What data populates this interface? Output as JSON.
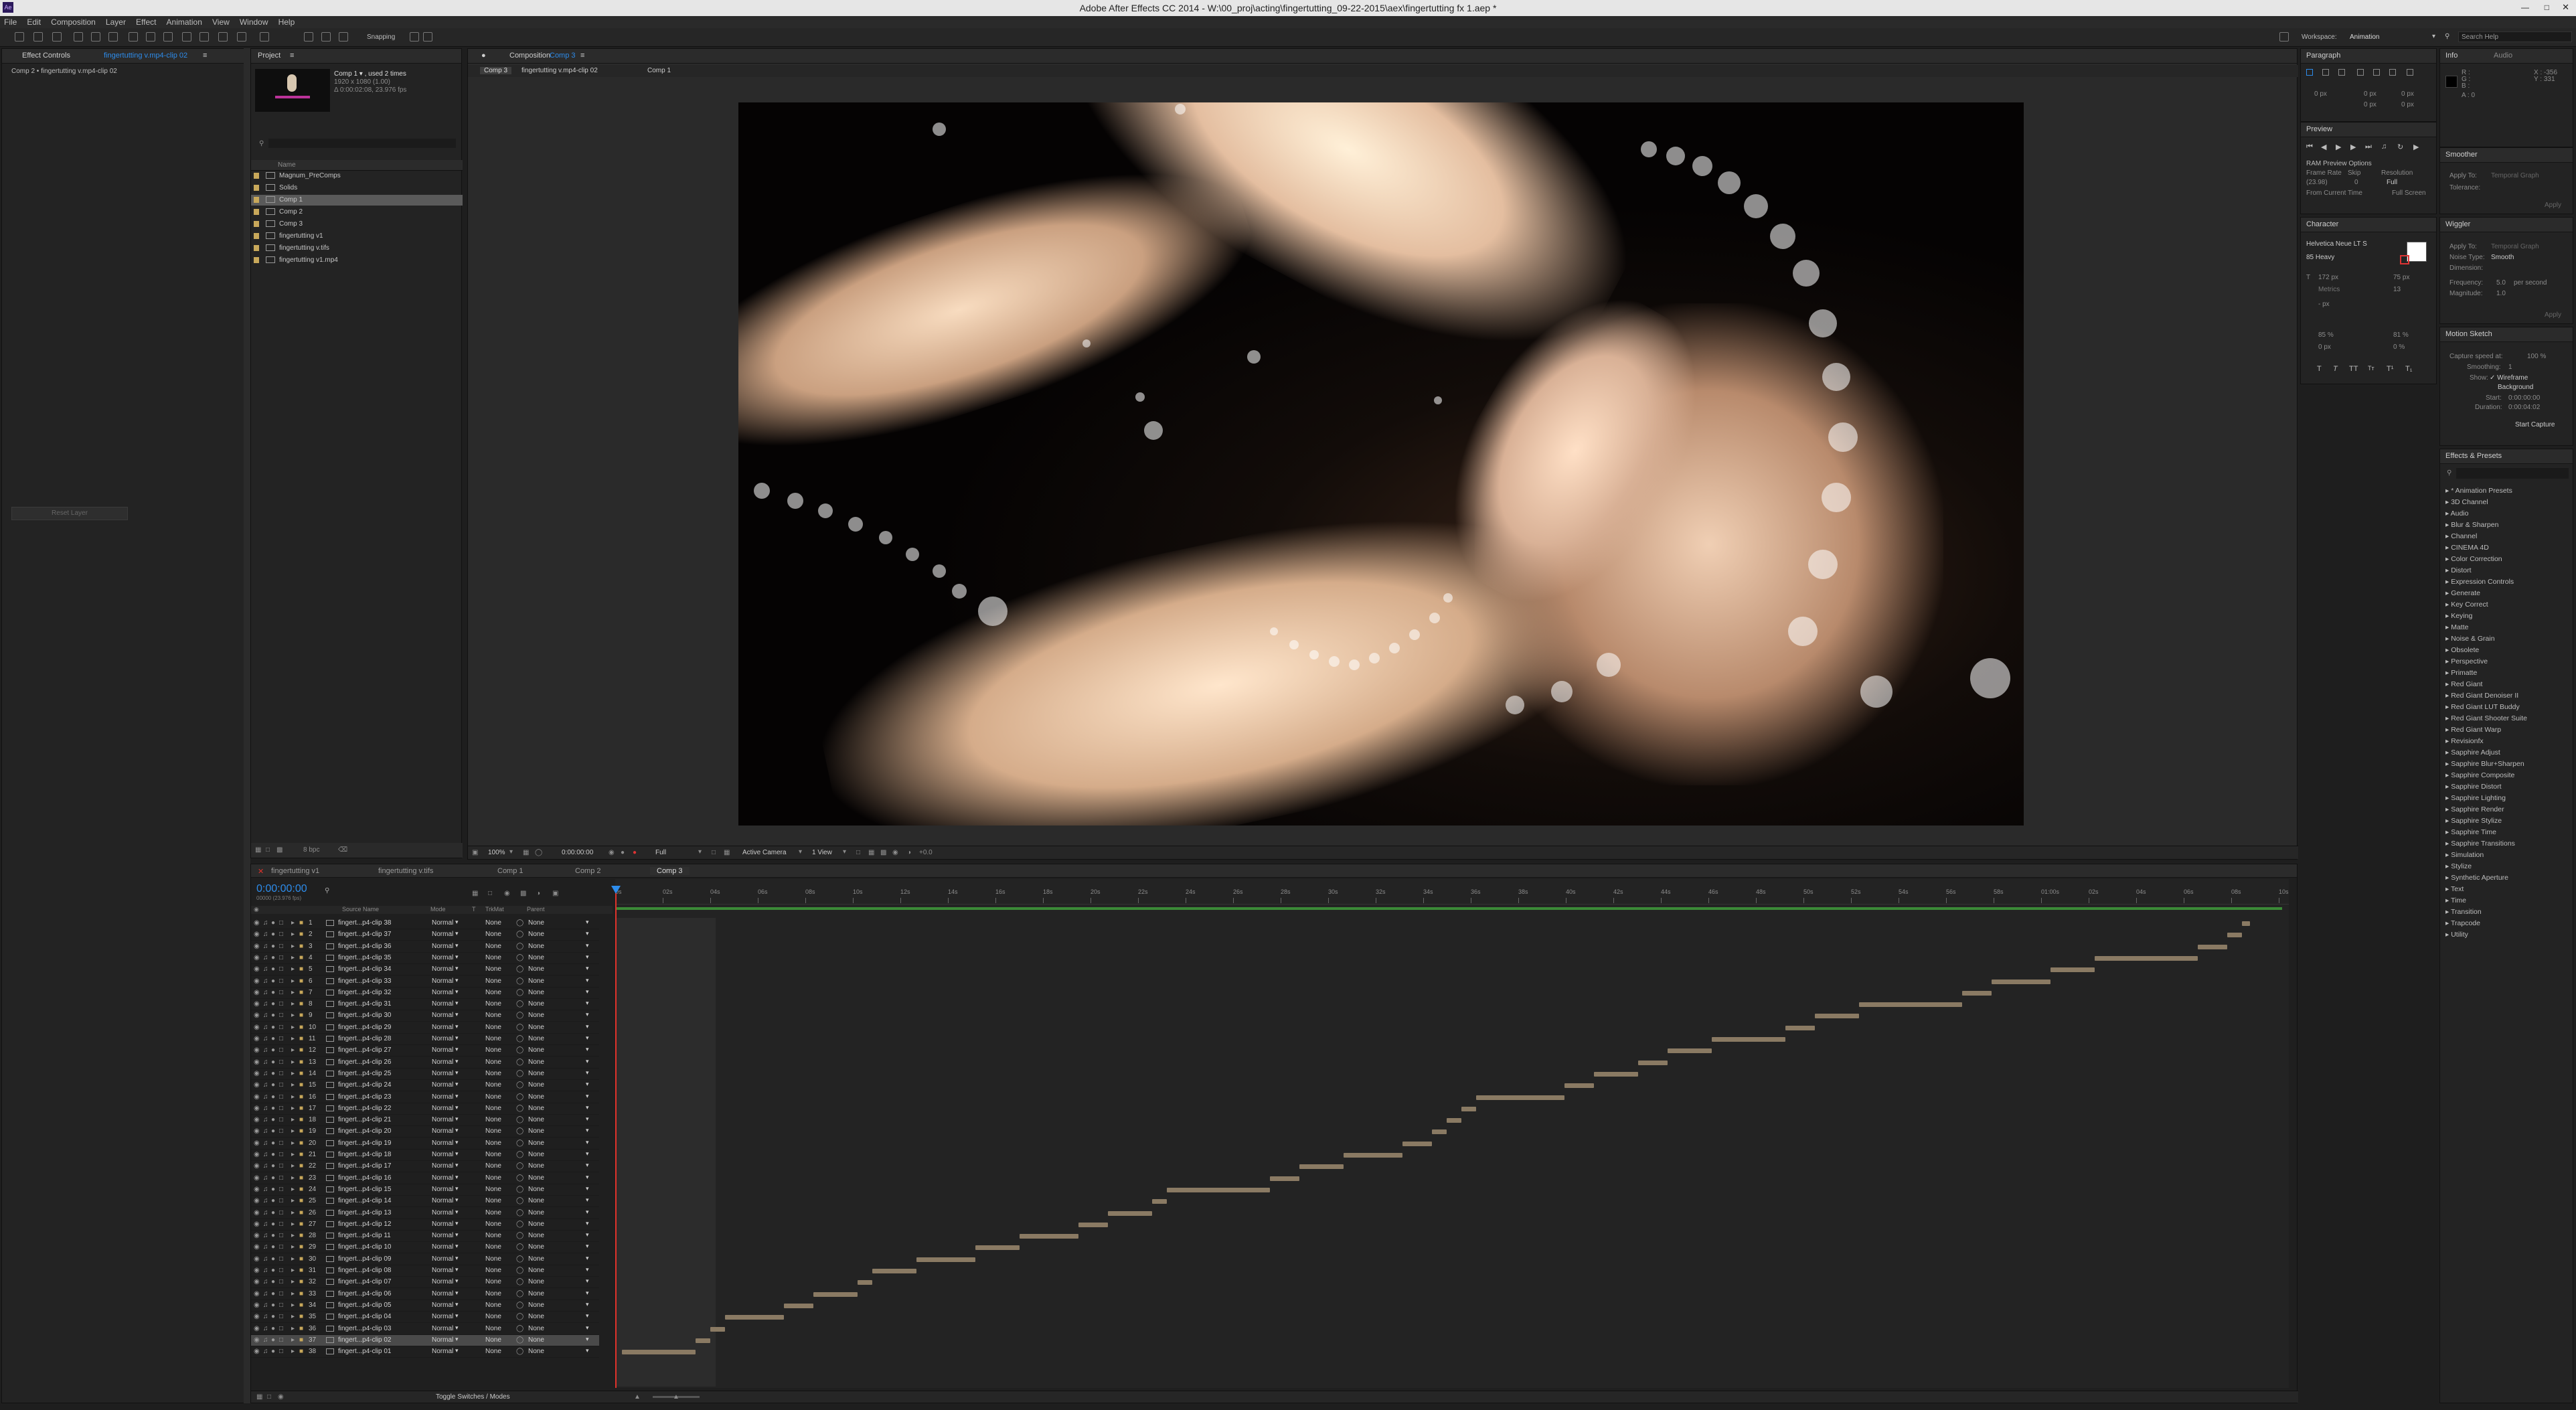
{
  "window": {
    "title": "Adobe After Effects CC 2014 - W:\\00_proj\\acting\\fingertutting_09-22-2015\\aex\\fingertutting fx 1.aep *"
  },
  "menu": [
    "File",
    "Edit",
    "Composition",
    "Layer",
    "Effect",
    "Animation",
    "View",
    "Window",
    "Help"
  ],
  "toolbar": {
    "snapping": "Snapping",
    "workspace_label": "Workspace:",
    "workspace_value": "Animation",
    "search_help": "Search Help"
  },
  "effect_controls": {
    "tab": "Effect Controls",
    "tab_file": "fingertutting v.mp4-clip 02",
    "breadcrumb": "Comp 2 • fingertutting v.mp4-clip 02",
    "button": "Reset Layer"
  },
  "project": {
    "tab": "Project",
    "comp_name": "Comp 1 ▾ , used 2 times",
    "comp_dims": "1920 x 1080 (1.00)",
    "comp_duration": "Δ 0:00:02:08, 23.976 fps",
    "column_name": "Name",
    "items": [
      "Magnum_PreComps",
      "Solids",
      "Comp 1",
      "Comp 2",
      "Comp 3",
      "fingertutting v1",
      "fingertutting v.tifs",
      "fingertutting v1.mp4"
    ],
    "bpc": "8 bpc"
  },
  "composition": {
    "tab": "Composition",
    "tab_comp": "Comp 3",
    "breadcrumbs": [
      "Comp 3",
      "fingertutting v.mp4-clip 02",
      "Comp 1"
    ],
    "footer": {
      "zoom": "100%",
      "timecode": "0:00:00:00",
      "resolution": "Full",
      "camera": "Active Camera",
      "views": "1 View",
      "exposure": "+0.0"
    }
  },
  "timeline": {
    "tabs": [
      "fingertutting v1",
      "fingertutting v.tifs",
      "Comp 1",
      "Comp 2",
      "Comp 3"
    ],
    "timecode": "0:00:00:00",
    "fps_line": "00000 (23.976 fps)",
    "columns": {
      "source": "Source Name",
      "mode": "Mode",
      "t": "T",
      "trkmat": "TrkMat",
      "parent": "Parent"
    },
    "ruler": [
      "0s",
      "02s",
      "04s",
      "06s",
      "08s",
      "10s",
      "12s",
      "14s",
      "16s",
      "18s",
      "20s",
      "22s",
      "24s",
      "26s",
      "28s",
      "30s",
      "32s",
      "34s",
      "36s",
      "38s",
      "40s",
      "42s",
      "44s",
      "46s",
      "48s",
      "50s",
      "52s",
      "54s",
      "56s",
      "58s",
      "01:00s",
      "02s",
      "04s",
      "06s",
      "08s",
      "10s"
    ],
    "layers": [
      "fingert...p4-clip 38",
      "fingert...p4-clip 37",
      "fingert...p4-clip 36",
      "fingert...p4-clip 35",
      "fingert...p4-clip 34",
      "fingert...p4-clip 33",
      "fingert...p4-clip 32",
      "fingert...p4-clip 31",
      "fingert...p4-clip 30",
      "fingert...p4-clip 29",
      "fingert...p4-clip 28",
      "fingert...p4-clip 27",
      "fingert...p4-clip 26",
      "fingert...p4-clip 25",
      "fingert...p4-clip 24",
      "fingert...p4-clip 23",
      "fingert...p4-clip 22",
      "fingert...p4-clip 21",
      "fingert...p4-clip 20",
      "fingert...p4-clip 19",
      "fingert...p4-clip 18",
      "fingert...p4-clip 17",
      "fingert...p4-clip 16",
      "fingert...p4-clip 15",
      "fingert...p4-clip 14",
      "fingert...p4-clip 13",
      "fingert...p4-clip 12",
      "fingert...p4-clip 11",
      "fingert...p4-clip 10",
      "fingert...p4-clip 09",
      "fingert...p4-clip 08",
      "fingert...p4-clip 07",
      "fingert...p4-clip 06",
      "fingert...p4-clip 05",
      "fingert...p4-clip 04",
      "fingert...p4-clip 03",
      "fingert...p4-clip 02",
      "fingert...p4-clip 01"
    ],
    "mode_value": "Normal",
    "trkmat_value": "None",
    "parent_value": "None",
    "toggle": "Toggle Switches / Modes"
  },
  "paragraph": {
    "tab": "Paragraph",
    "px": [
      "0 px",
      "0 px",
      "0 px",
      "0 px",
      "0 px"
    ]
  },
  "preview": {
    "tab": "Preview",
    "ram": "RAM Preview Options",
    "frame_rate_label": "Frame Rate",
    "skip_label": "Skip",
    "resolution_label": "Resolution",
    "frame_rate": "(23.98)",
    "skip": "0",
    "resolution": "Full",
    "from_current": "From Current Time",
    "full_screen": "Full Screen"
  },
  "character": {
    "tab": "Character",
    "font": "Helvetica Neue LT S",
    "style": "85 Heavy",
    "size": "172 px",
    "leading": "75 px",
    "kerning": "Metrics",
    "tracking": "13",
    "stroke": "- px",
    "vscale": "85 %",
    "hscale": "81 %",
    "baseline": "0 px",
    "tsume": "0 %"
  },
  "info": {
    "tab": "Info",
    "tab2": "Audio",
    "r": "R :",
    "g": "G :",
    "b": "B :",
    "a": "A : 0",
    "x": "X : -356",
    "y": "Y : 331"
  },
  "smoother": {
    "tab": "Smoother",
    "apply_to": "Apply To:",
    "apply_val": "Temporal Graph",
    "tolerance": "Tolerance:",
    "apply_btn": "Apply"
  },
  "wiggler": {
    "tab": "Wiggler",
    "apply_to": "Apply To:",
    "apply_val": "Temporal Graph",
    "noise": "Noise Type:",
    "noise_val": "Smooth",
    "dimension": "Dimension:",
    "frequency": "Frequency:",
    "freq_val": "5.0",
    "per_sec": "per second",
    "magnitude": "Magnitude:",
    "mag_val": "1.0",
    "apply_btn": "Apply"
  },
  "motion_sketch": {
    "tab": "Motion Sketch",
    "capture": "Capture speed at:",
    "capture_val": "100 %",
    "smoothing": "Smoothing:",
    "smoothing_val": "1",
    "show": "Show:",
    "wireframe": "Wireframe",
    "background": "Background",
    "start": "Start:",
    "start_val": "0:00:00:00",
    "duration": "Duration:",
    "duration_val": "0:00:04:02",
    "button": "Start Capture"
  },
  "effects_presets": {
    "tab": "Effects & Presets",
    "items": [
      "* Animation Presets",
      "3D Channel",
      "Audio",
      "Blur & Sharpen",
      "Channel",
      "CINEMA 4D",
      "Color Correction",
      "Distort",
      "Expression Controls",
      "Generate",
      "Key Correct",
      "Keying",
      "Matte",
      "Noise & Grain",
      "Obsolete",
      "Perspective",
      "Primatte",
      "Red Giant",
      "Red Giant Denoiser II",
      "Red Giant LUT Buddy",
      "Red Giant Shooter Suite",
      "Red Giant Warp",
      "Revisionfx",
      "Sapphire Adjust",
      "Sapphire Blur+Sharpen",
      "Sapphire Composite",
      "Sapphire Distort",
      "Sapphire Lighting",
      "Sapphire Render",
      "Sapphire Stylize",
      "Sapphire Time",
      "Sapphire Transitions",
      "Simulation",
      "Stylize",
      "Synthetic Aperture",
      "Text",
      "Time",
      "Transition",
      "Trapcode",
      "Utility"
    ]
  },
  "colors": {
    "accent": "#2d8ceb",
    "clip": "#8a7a63",
    "playhead": "#e0332b",
    "workarea": "#4fb34a"
  },
  "keyframe_levels": [
    0.0,
    0.01,
    0.02,
    0.07,
    0.03,
    0.04,
    0.02,
    0.07,
    0.03,
    0.02,
    0.05,
    0.03,
    0.02,
    0.03,
    0.02,
    0.06,
    0.01,
    0.01,
    0.01,
    0.02,
    0.04,
    0.03,
    0.02,
    0.07,
    0.01,
    0.03,
    0.02,
    0.04,
    0.03,
    0.04,
    0.03,
    0.01,
    0.03,
    0.02,
    0.04,
    0.01,
    0.01,
    0.05
  ]
}
